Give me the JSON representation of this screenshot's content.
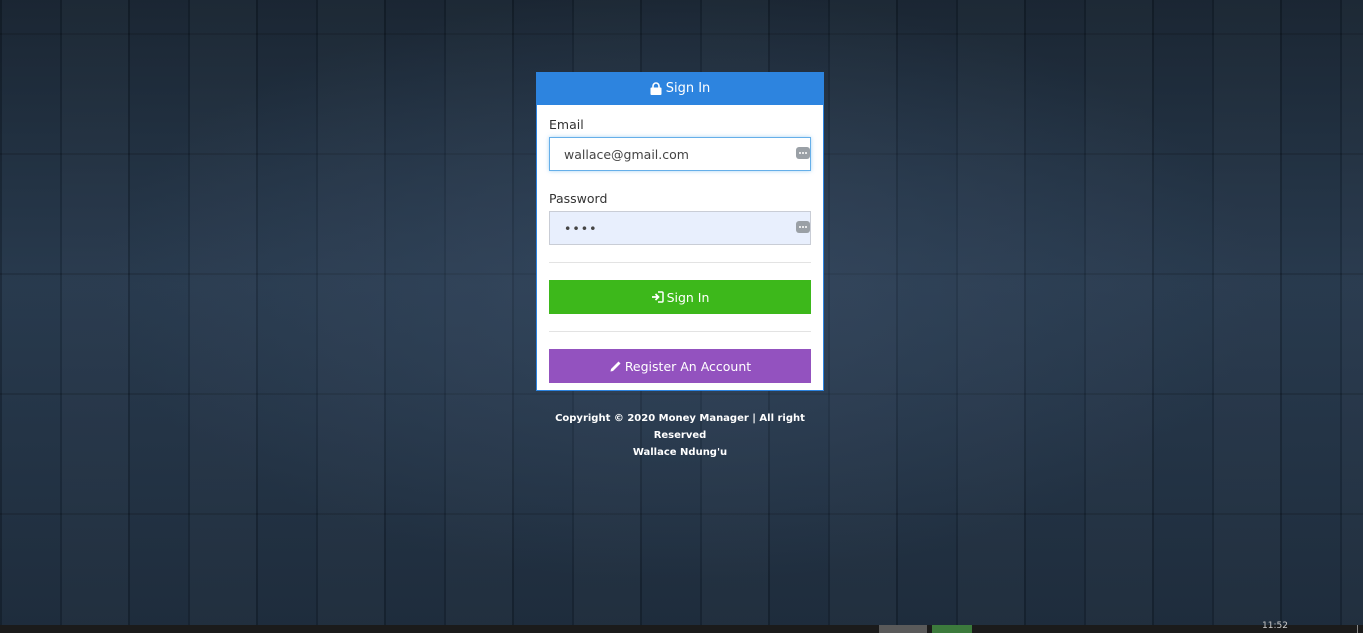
{
  "login": {
    "heading": "Sign In",
    "email_label": "Email",
    "email_value": "wallace@gmail.com",
    "password_label": "Password",
    "password_value": "••••",
    "signin_button": "Sign In",
    "register_button": "Register An Account"
  },
  "footer": {
    "copyright": "Copyright © 2020 Money Manager | All right Reserved",
    "author": "Wallace Ndung'u"
  },
  "taskbar": {
    "clock": "11:52"
  },
  "colors": {
    "header_blue": "#2d84df",
    "signin_green": "#3db81b",
    "register_purple": "#9352bf"
  },
  "icons": {
    "heading": "lock-icon",
    "signin": "sign-in-icon",
    "register": "pencil-icon",
    "password_manager": "password-manager-icon"
  }
}
